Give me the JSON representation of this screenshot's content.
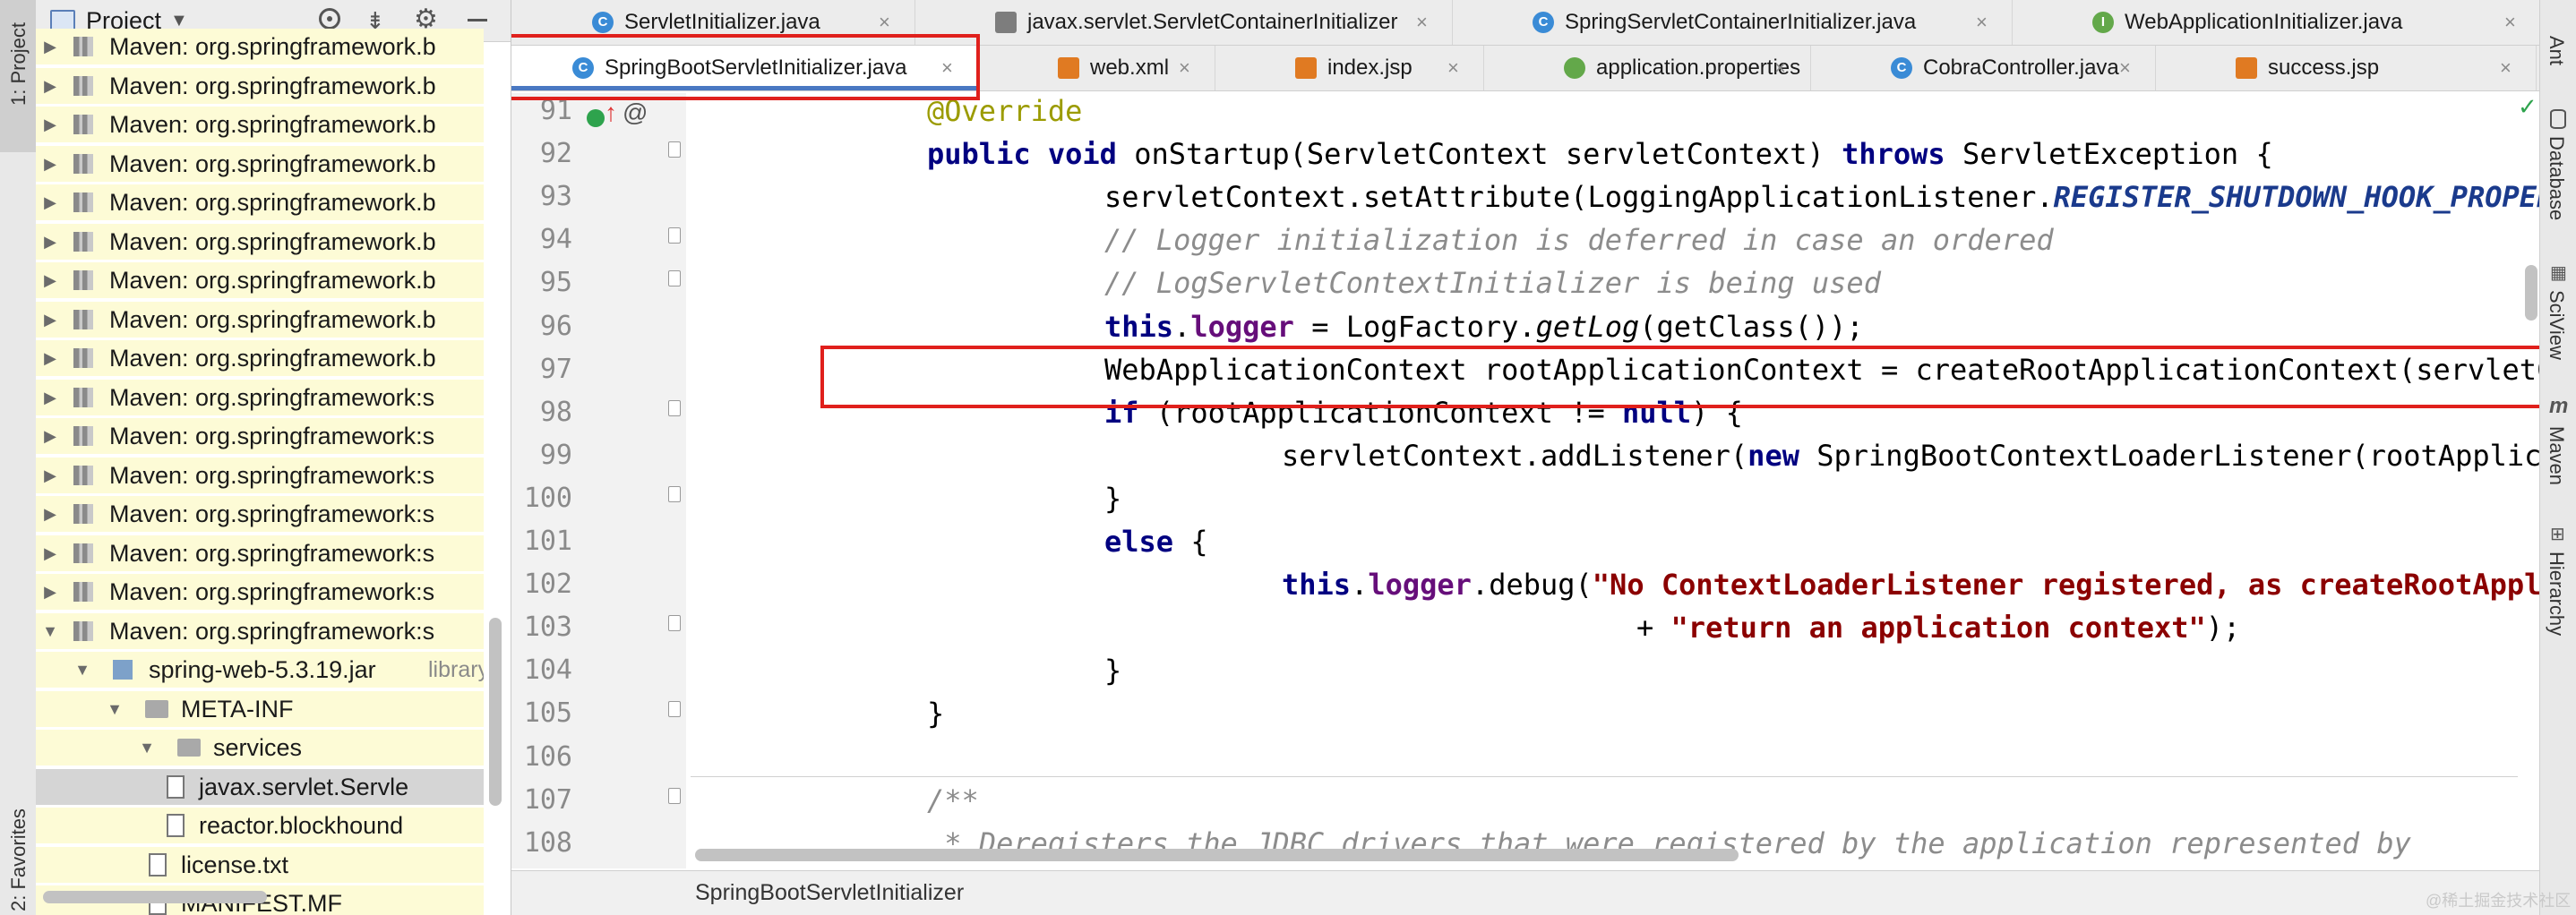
{
  "left_strip": {
    "project_label": "1: Project",
    "favorites_label": "2: Favorites"
  },
  "project_panel": {
    "title": "Project",
    "tree": [
      {
        "label": "Maven: org.springframework.b",
        "kind": "lib",
        "arrow": "▶"
      },
      {
        "label": "Maven: org.springframework.b",
        "kind": "lib",
        "arrow": "▶"
      },
      {
        "label": "Maven: org.springframework.b",
        "kind": "lib",
        "arrow": "▶"
      },
      {
        "label": "Maven: org.springframework.b",
        "kind": "lib",
        "arrow": "▶"
      },
      {
        "label": "Maven: org.springframework.b",
        "kind": "lib",
        "arrow": "▶"
      },
      {
        "label": "Maven: org.springframework.b",
        "kind": "lib",
        "arrow": "▶"
      },
      {
        "label": "Maven: org.springframework.b",
        "kind": "lib",
        "arrow": "▶"
      },
      {
        "label": "Maven: org.springframework.b",
        "kind": "lib",
        "arrow": "▶"
      },
      {
        "label": "Maven: org.springframework.b",
        "kind": "lib",
        "arrow": "▶"
      },
      {
        "label": "Maven: org.springframework:s",
        "kind": "lib",
        "arrow": "▶"
      },
      {
        "label": "Maven: org.springframework:s",
        "kind": "lib",
        "arrow": "▶"
      },
      {
        "label": "Maven: org.springframework:s",
        "kind": "lib",
        "arrow": "▶"
      },
      {
        "label": "Maven: org.springframework:s",
        "kind": "lib",
        "arrow": "▶"
      },
      {
        "label": "Maven: org.springframework:s",
        "kind": "lib",
        "arrow": "▶"
      },
      {
        "label": "Maven: org.springframework:s",
        "kind": "lib",
        "arrow": "▶"
      },
      {
        "label": "Maven: org.springframework:s",
        "kind": "lib",
        "arrow": "▼"
      },
      {
        "label": "spring-web-5.3.19.jar",
        "suffix": "library",
        "kind": "jar",
        "arrow": "▼"
      },
      {
        "label": "META-INF",
        "kind": "folder",
        "arrow": "▼"
      },
      {
        "label": "services",
        "kind": "folder",
        "arrow": "▼"
      },
      {
        "label": "javax.servlet.Servle",
        "kind": "file-selected",
        "arrow": ""
      },
      {
        "label": "reactor.blockhound",
        "kind": "file",
        "arrow": ""
      },
      {
        "label": "license.txt",
        "kind": "file",
        "arrow": ""
      },
      {
        "label": "MANIFEST.MF",
        "kind": "file",
        "arrow": ""
      }
    ]
  },
  "tabs_row1": [
    {
      "label": "ServletInitializer.java",
      "icon": "C",
      "color": "#3a8bd6"
    },
    {
      "label": "javax.servlet.ServletContainerInitializer",
      "icon": "file",
      "color": "#7d7d7d"
    },
    {
      "label": "SpringServletContainerInitializer.java",
      "icon": "C",
      "color": "#3a8bd6"
    },
    {
      "label": "WebApplicationInitializer.java",
      "icon": "I",
      "color": "#63a84a"
    }
  ],
  "tabs_row2": [
    {
      "label": "SpringBootServletInitializer.java",
      "icon": "C",
      "color": "#3a8bd6",
      "active": true
    },
    {
      "label": "web.xml",
      "icon": "xml",
      "color": "#e07a22"
    },
    {
      "label": "index.jsp",
      "icon": "JSP",
      "color": "#e07a22"
    },
    {
      "label": "application.properties",
      "icon": "gear",
      "color": "#63a84a"
    },
    {
      "label": "CobraController.java",
      "icon": "C",
      "color": "#3a8bd6"
    },
    {
      "label": "success.jsp",
      "icon": "JSP",
      "color": "#e07a22"
    }
  ],
  "tab_close_glyph": "×",
  "line_numbers": [
    "91",
    "92",
    "93",
    "94",
    "95",
    "96",
    "97",
    "98",
    "99",
    "100",
    "101",
    "102",
    "103",
    "104",
    "105",
    "106",
    "107",
    "108"
  ],
  "code": {
    "l91": "@Override",
    "l92_a": "public void",
    "l92_b": " onStartup(ServletContext servletContext) ",
    "l92_c": "throws",
    "l92_d": " ServletException {",
    "l93_a": "servletContext.setAttribute(LoggingApplicationListener.",
    "l93_b": "REGISTER_SHUTDOWN_HOOK_PROPERTY",
    "l94": "// Logger initialization is deferred in case an ordered",
    "l95": "// LogServletContextInitializer is being used",
    "l96_a": "this",
    "l96_b": ".",
    "l96_c": "logger",
    "l96_d": " = LogFactory.",
    "l96_e": "getLog",
    "l96_f": "(getClass());",
    "l97": "WebApplicationContext rootApplicationContext = createRootApplicationContext(servletCon",
    "l98_a": "if",
    "l98_b": " (rootApplicationContext != ",
    "l98_c": "null",
    "l98_d": ") {",
    "l99_a": "servletContext.addListener(",
    "l99_b": "new",
    "l99_c": " SpringBootContextLoaderListener(rootApplicationCont",
    "l100": "}",
    "l101_a": "else",
    "l101_b": " {",
    "l102_a": "this",
    "l102_b": ".",
    "l102_c": "logger",
    "l102_d": ".debug(",
    "l102_e": "\"No ContextLoaderListener registered, as createRootApplicationCo",
    "l103_a": "+ ",
    "l103_b": "\"return an application context\"",
    "l103_c": ");",
    "l104": "}",
    "l105": "}",
    "l106": "",
    "l107": "/**",
    "l108": " * Deregisters the JDBC drivers that were registered by the application represented by"
  },
  "status_bar": {
    "breadcrumb": "SpringBootServletInitializer"
  },
  "right_strip": {
    "ant": "Ant",
    "database": "Database",
    "sciview": "SciView",
    "maven": "Maven",
    "hierarchy": "Hierarchy"
  },
  "watermark": "@稀土掘金技术社区",
  "colors": {
    "highlight_box": "#e0201c",
    "library_bg": "#fdfbd6",
    "gutter_bg": "#f2f2f2"
  }
}
